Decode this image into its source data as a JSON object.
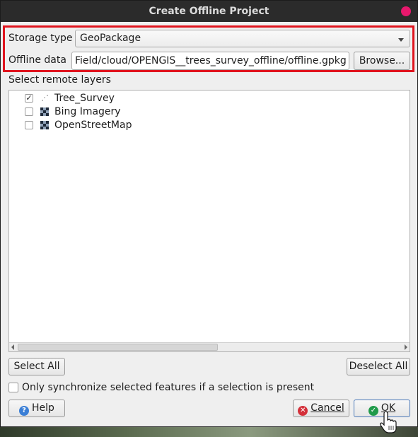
{
  "window": {
    "title": "Create Offline Project"
  },
  "storage": {
    "label": "Storage type",
    "value": "GeoPackage"
  },
  "offline": {
    "label": "Offline data",
    "path": "Field/cloud/OPENGIS__trees_survey_offline/offline.gpkg",
    "browse_label": "Browse..."
  },
  "layers": {
    "section_label": "Select remote layers",
    "items": [
      {
        "label": "Tree_Survey",
        "checked": true,
        "icon": "point-layer-icon"
      },
      {
        "label": "Bing Imagery",
        "checked": false,
        "icon": "raster-layer-icon"
      },
      {
        "label": "OpenStreetMap",
        "checked": false,
        "icon": "raster-layer-icon"
      }
    ]
  },
  "actions": {
    "select_all": "Select All",
    "deselect_all": "Deselect All",
    "only_sync_label": "Only synchronize selected features if a selection is present"
  },
  "footer": {
    "help": "Help",
    "cancel": "Cancel",
    "ok": "OK"
  },
  "colors": {
    "highlight": "#e0141e",
    "close": "#e8186d",
    "help_icon": "#3b7fd6",
    "cancel_icon": "#d4303a",
    "ok_icon": "#1f9a4a"
  }
}
